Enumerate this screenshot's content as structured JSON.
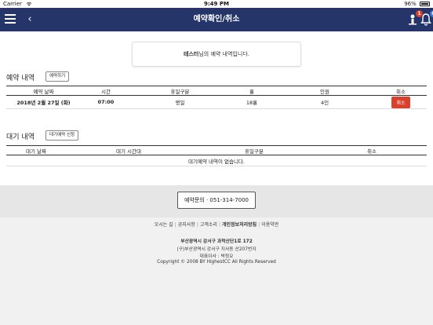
{
  "status_bar": {
    "carrier": "Carrier",
    "time": "9:49 PM",
    "battery": "96%"
  },
  "navbar": {
    "title": "예약확인/취소",
    "back_symbol": "‹",
    "user_badge": "1",
    "bell_badge": "0",
    "color": "#253569"
  },
  "notice": {
    "name": "테스터",
    "text": "님의 예약 내역입니다."
  },
  "reservations": {
    "title": "예약 내역",
    "button": "예약하기",
    "headers": [
      "예약 날짜",
      "시간",
      "휴일구분",
      "홀",
      "인원",
      "취소"
    ],
    "rows": [
      {
        "date": "2018년 2월 27일 (화)",
        "time": "07:00",
        "day_type": "평일",
        "hole": "18홀",
        "people": "4인",
        "cancel": "취소"
      }
    ]
  },
  "waiting": {
    "title": "대기 내역",
    "button": "대기예약 신청",
    "headers": [
      "대기 날짜",
      "대기 시간대",
      "휴일구분",
      "취소"
    ],
    "empty": "대기예약 내역이 없습니다."
  },
  "footer": {
    "contact": "예약문의  ·  051-314-7000",
    "links": [
      "오시는 길",
      "공지사항",
      "고객소리",
      "개인정보처리방침",
      "이용약관"
    ],
    "address_main": "부산광역시 강서구 과학산단1로 172",
    "address_old": "(구)부산광역시 강서구 지사동 산207번지",
    "ceo": "대표이사 : 박정오",
    "copyright": "Copyright © 2008 BY HighestCC All Rights Reserved"
  },
  "colors": {
    "cancel": "#d9412d",
    "badge": "#d9412d",
    "bell_badge": "#3a78d6"
  }
}
